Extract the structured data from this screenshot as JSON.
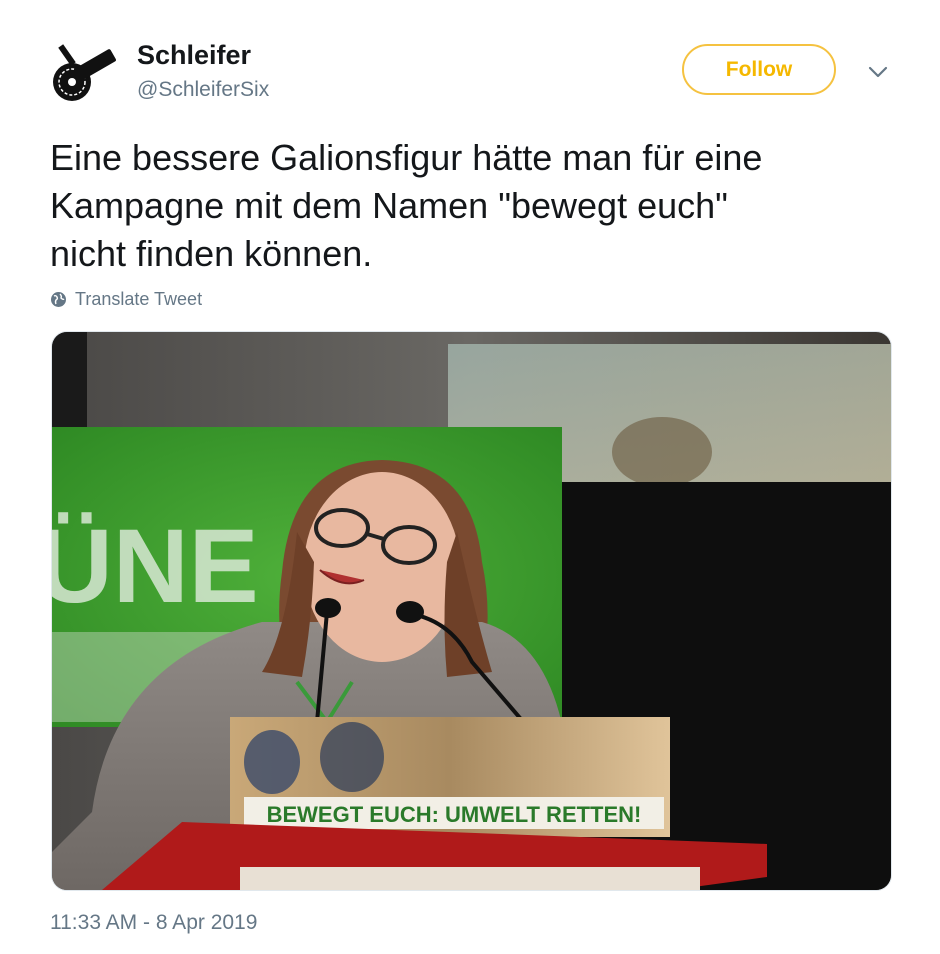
{
  "user": {
    "display_name": "Schleifer",
    "handle": "@SchleiferSix",
    "avatar_icon": "angle-grinder-icon"
  },
  "actions": {
    "follow_label": "Follow",
    "more_icon": "chevron-down-icon"
  },
  "tweet": {
    "lines": [
      "Eine bessere Galionsfigur hätte man für eine",
      "Kampagne mit dem Namen \"bewegt euch\"",
      "nicht finden können."
    ],
    "translate_label": "Translate Tweet",
    "timestamp": "11:33 AM - 8 Apr 2019"
  },
  "photo": {
    "banner_letters": "ÜNE",
    "sign_text": "BEWEGT EUCH: UMWELT RETTEN!"
  },
  "colors": {
    "accent": "#f5b800",
    "text": "#14171a",
    "muted": "#657786",
    "banner_green": "#3a9a2a"
  }
}
